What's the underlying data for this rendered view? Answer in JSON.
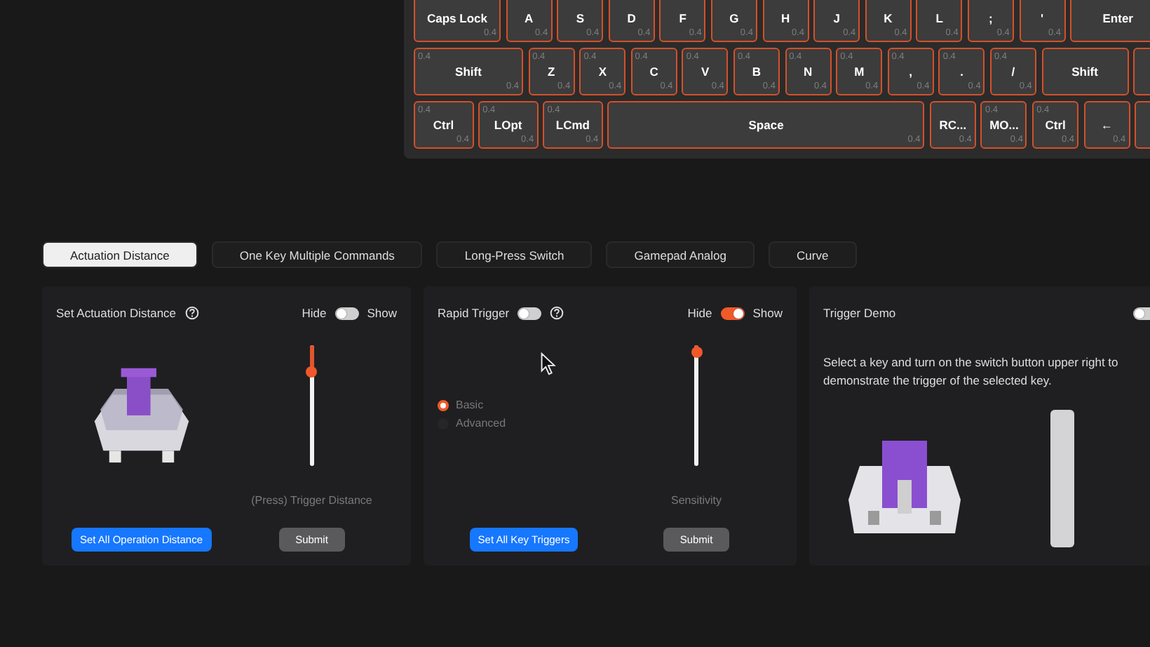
{
  "keyboard": {
    "rows": [
      {
        "keys": [
          {
            "label": "Caps Lock",
            "kind": "caps",
            "legends": [
              "0.4"
            ]
          },
          {
            "label": "A",
            "kind": "letter",
            "legends": [
              "0.4"
            ]
          },
          {
            "label": "S",
            "kind": "letter",
            "legends": [
              "0.4"
            ]
          },
          {
            "label": "D",
            "kind": "letter",
            "legends": [
              "0.4"
            ]
          },
          {
            "label": "F",
            "kind": "letter",
            "legends": [
              "0.4"
            ]
          },
          {
            "label": "G",
            "kind": "letter",
            "legends": [
              "0.4"
            ]
          },
          {
            "label": "H",
            "kind": "letter",
            "legends": [
              "0.4"
            ]
          },
          {
            "label": "J",
            "kind": "letter",
            "legends": [
              "0.4"
            ]
          },
          {
            "label": "K",
            "kind": "letter",
            "legends": [
              "0.4"
            ]
          },
          {
            "label": "L",
            "kind": "letter",
            "legends": [
              "0.4"
            ]
          },
          {
            "label": ";",
            "kind": "letter",
            "legends": [
              "0.4"
            ]
          },
          {
            "label": "'",
            "kind": "letter",
            "legends": [
              "0.4"
            ]
          },
          {
            "label": "Enter",
            "kind": "enter"
          }
        ]
      },
      {
        "keys": [
          {
            "label": "Shift",
            "kind": "shift",
            "legends": [
              "0.4",
              "0.4"
            ]
          },
          {
            "label": "Z",
            "kind": "letter",
            "legends": [
              "0.4",
              "0.4"
            ]
          },
          {
            "label": "X",
            "kind": "letter",
            "legends": [
              "0.4",
              "0.4"
            ]
          },
          {
            "label": "C",
            "kind": "letter",
            "legends": [
              "0.4",
              "0.4"
            ]
          },
          {
            "label": "V",
            "kind": "letter",
            "legends": [
              "0.4",
              "0.4"
            ]
          },
          {
            "label": "B",
            "kind": "letter",
            "legends": [
              "0.4",
              "0.4"
            ]
          },
          {
            "label": "N",
            "kind": "letter",
            "legends": [
              "0.4",
              "0.4"
            ]
          },
          {
            "label": "M",
            "kind": "letter",
            "legends": [
              "0.4",
              "0.4"
            ]
          },
          {
            "label": ",",
            "kind": "letter",
            "legends": [
              "0.4",
              "0.4"
            ]
          },
          {
            "label": ".",
            "kind": "letter",
            "legends": [
              "0.4",
              "0.4"
            ]
          },
          {
            "label": "/",
            "kind": "letter",
            "legends": [
              "0.4",
              "0.4"
            ]
          },
          {
            "label": "Shift",
            "kind": "rshift"
          },
          {
            "kind": "edge"
          }
        ]
      },
      {
        "keys": [
          {
            "label": "Ctrl",
            "kind": "mod",
            "legends": [
              "0.4",
              "0.4"
            ]
          },
          {
            "label": "LOpt",
            "kind": "mod",
            "legends": [
              "0.4",
              "0.4"
            ]
          },
          {
            "label": "LCmd",
            "kind": "mod",
            "legends": [
              "0.4",
              "0.4"
            ]
          },
          {
            "label": "Space",
            "kind": "space",
            "legends": [
              "0.4"
            ]
          },
          {
            "label": "RC...",
            "kind": "letter",
            "legends": [
              "0.4"
            ]
          },
          {
            "label": "MO...",
            "kind": "letter",
            "legends": [
              "0.4",
              "0.4"
            ]
          },
          {
            "label": "Ctrl",
            "kind": "letter",
            "legends": [
              "0.4",
              "0.4"
            ]
          },
          {
            "label": "←",
            "kind": "letter",
            "legends": [
              "0.4"
            ]
          },
          {
            "kind": "edge"
          }
        ]
      }
    ]
  },
  "tabs": [
    {
      "label": "Actuation Distance",
      "selected": true
    },
    {
      "label": "One Key Multiple Commands",
      "selected": false
    },
    {
      "label": "Long-Press Switch",
      "selected": false
    },
    {
      "label": "Gamepad Analog",
      "selected": false
    },
    {
      "label": "Curve",
      "selected": false
    }
  ],
  "actuation_panel": {
    "title": "Set Actuation Distance",
    "hide_label": "Hide",
    "show_label": "Show",
    "show_on": false,
    "slider": {
      "level": 0.22
    },
    "slider_label": "(Press) Trigger Distance",
    "set_all_button": "Set All Operation Distance",
    "submit_button": "Submit"
  },
  "rapid_panel": {
    "title": "Rapid Trigger",
    "rapid_on": false,
    "hide_label": "Hide",
    "show_label": "Show",
    "show_on": true,
    "modes": [
      {
        "label": "Basic",
        "selected": true
      },
      {
        "label": "Advanced",
        "selected": false
      }
    ],
    "slider": {
      "level": 0.06
    },
    "slider_label": "Sensitivity",
    "set_all_button": "Set All Key Triggers",
    "submit_button": "Submit"
  },
  "demo_panel": {
    "title": "Trigger Demo",
    "demo_on": false,
    "description": "Select a key and turn on the switch button upper right to demonstrate the trigger of the selected key."
  }
}
